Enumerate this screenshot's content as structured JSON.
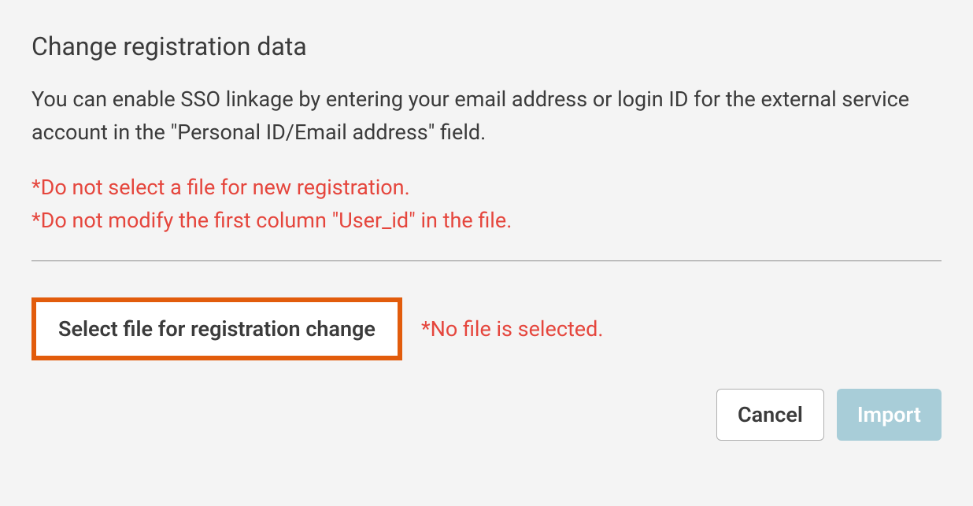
{
  "heading": "Change registration data",
  "description": "You can enable SSO linkage by entering your email address or login ID for the external service account in the \"Personal ID/Email address\" field.",
  "warnings": {
    "line1": "*Do not select a file for new registration.",
    "line2": "*Do not modify the first column \"User_id\" in the file."
  },
  "select_file_label": "Select file for registration change",
  "no_file_text": "*No file is selected.",
  "actions": {
    "cancel": "Cancel",
    "import": "Import"
  }
}
